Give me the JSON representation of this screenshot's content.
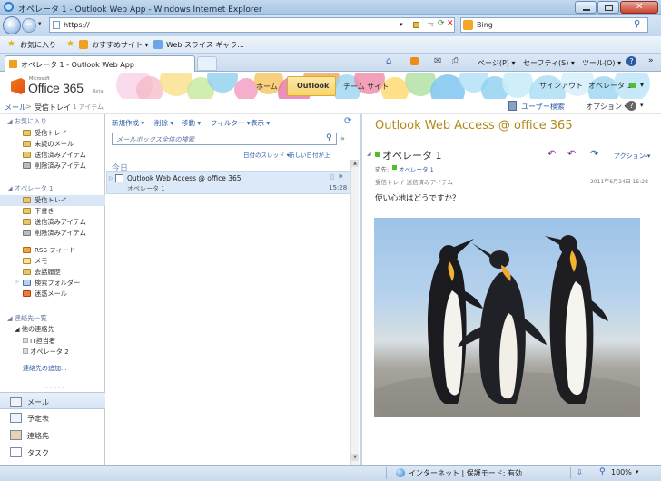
{
  "window": {
    "title": "オペレータ 1 - Outlook Web App - Windows Internet Explorer"
  },
  "browser": {
    "address": "https://",
    "search_engine": "Bing",
    "favorites": {
      "label": "お気に入り",
      "suggested": "おすすめサイト ▾",
      "slices": "Web スライス ギャラ..."
    },
    "tab_label": "オペレータ 1 - Outlook Web App",
    "cmd": {
      "page": "ページ(P) ▾",
      "safety": "セーフティ(S) ▾",
      "tools": "ツール(O) ▾"
    }
  },
  "owa": {
    "logo": {
      "ms": "Microsoft",
      "brand": "Office 365",
      "beta": "Beta"
    },
    "nav": {
      "home": "ホーム",
      "outlook": "Outlook",
      "team_site": "チーム サイト"
    },
    "signout": "サインアウト",
    "user": "オペレータ 1",
    "breadcrumb": {
      "mail": "メール",
      "sep": ">",
      "folder": "受信トレイ",
      "count": "1 アイテム"
    },
    "user_search": "ユーザー検索",
    "options": "オプション ▾"
  },
  "leftnav": {
    "favorites_header": "◢ お気に入り",
    "favorites": [
      "受信トレイ",
      "未読のメール",
      "送信済みアイテム",
      "削除済みアイテム"
    ],
    "mailbox_header": "◢ オペレータ 1",
    "folders": [
      "受信トレイ",
      "下書き",
      "送信済みアイテム",
      "削除済みアイテム"
    ],
    "folders2": [
      "RSS フィード",
      "メモ",
      "会話履歴",
      "検索フォルダー",
      "迷惑メール"
    ],
    "contacts_header": "◢ 連絡先一覧",
    "contacts_group": "◢ 他の連絡先",
    "contacts": [
      "IT担当者",
      "オペレータ 2"
    ],
    "add_contacts": "連絡先の追加...",
    "dots": "• • • • •",
    "bottom": [
      "メール",
      "予定表",
      "連絡先",
      "タスク"
    ]
  },
  "list": {
    "toolbar": {
      "new": "新規作成 ▾",
      "delete": "削除 ▾",
      "move": "移動 ▾",
      "filter": "フィルター ▾",
      "view": "表示 ▾"
    },
    "search_placeholder": "メールボックス全体の検索",
    "sort": {
      "by_date": "日付のスレッド ▾",
      "newest": "新しい日付が上"
    },
    "group_today": "今日",
    "message": {
      "subject": "Outlook Web Access @ office 365",
      "from": "オペレータ 1",
      "time": "15:28"
    }
  },
  "reading": {
    "subject": "Outlook Web Access @ office 365",
    "sender": "オペレータ 1",
    "actions_label": "アクション ▾",
    "to_label": "宛先:",
    "to": "オペレータ 1",
    "folder_path": "受信トレイ  送信済みアイテム",
    "date": "2011年6月24日 15:28",
    "body": "使い心地はどうですか？"
  },
  "status": {
    "zone": "インターネット | 保護モード: 有効",
    "zoom": "100%"
  },
  "colors": {
    "accent": "#c89a12",
    "owa_blue": "#2a5aa6",
    "title_gold": "#b28a1a"
  }
}
